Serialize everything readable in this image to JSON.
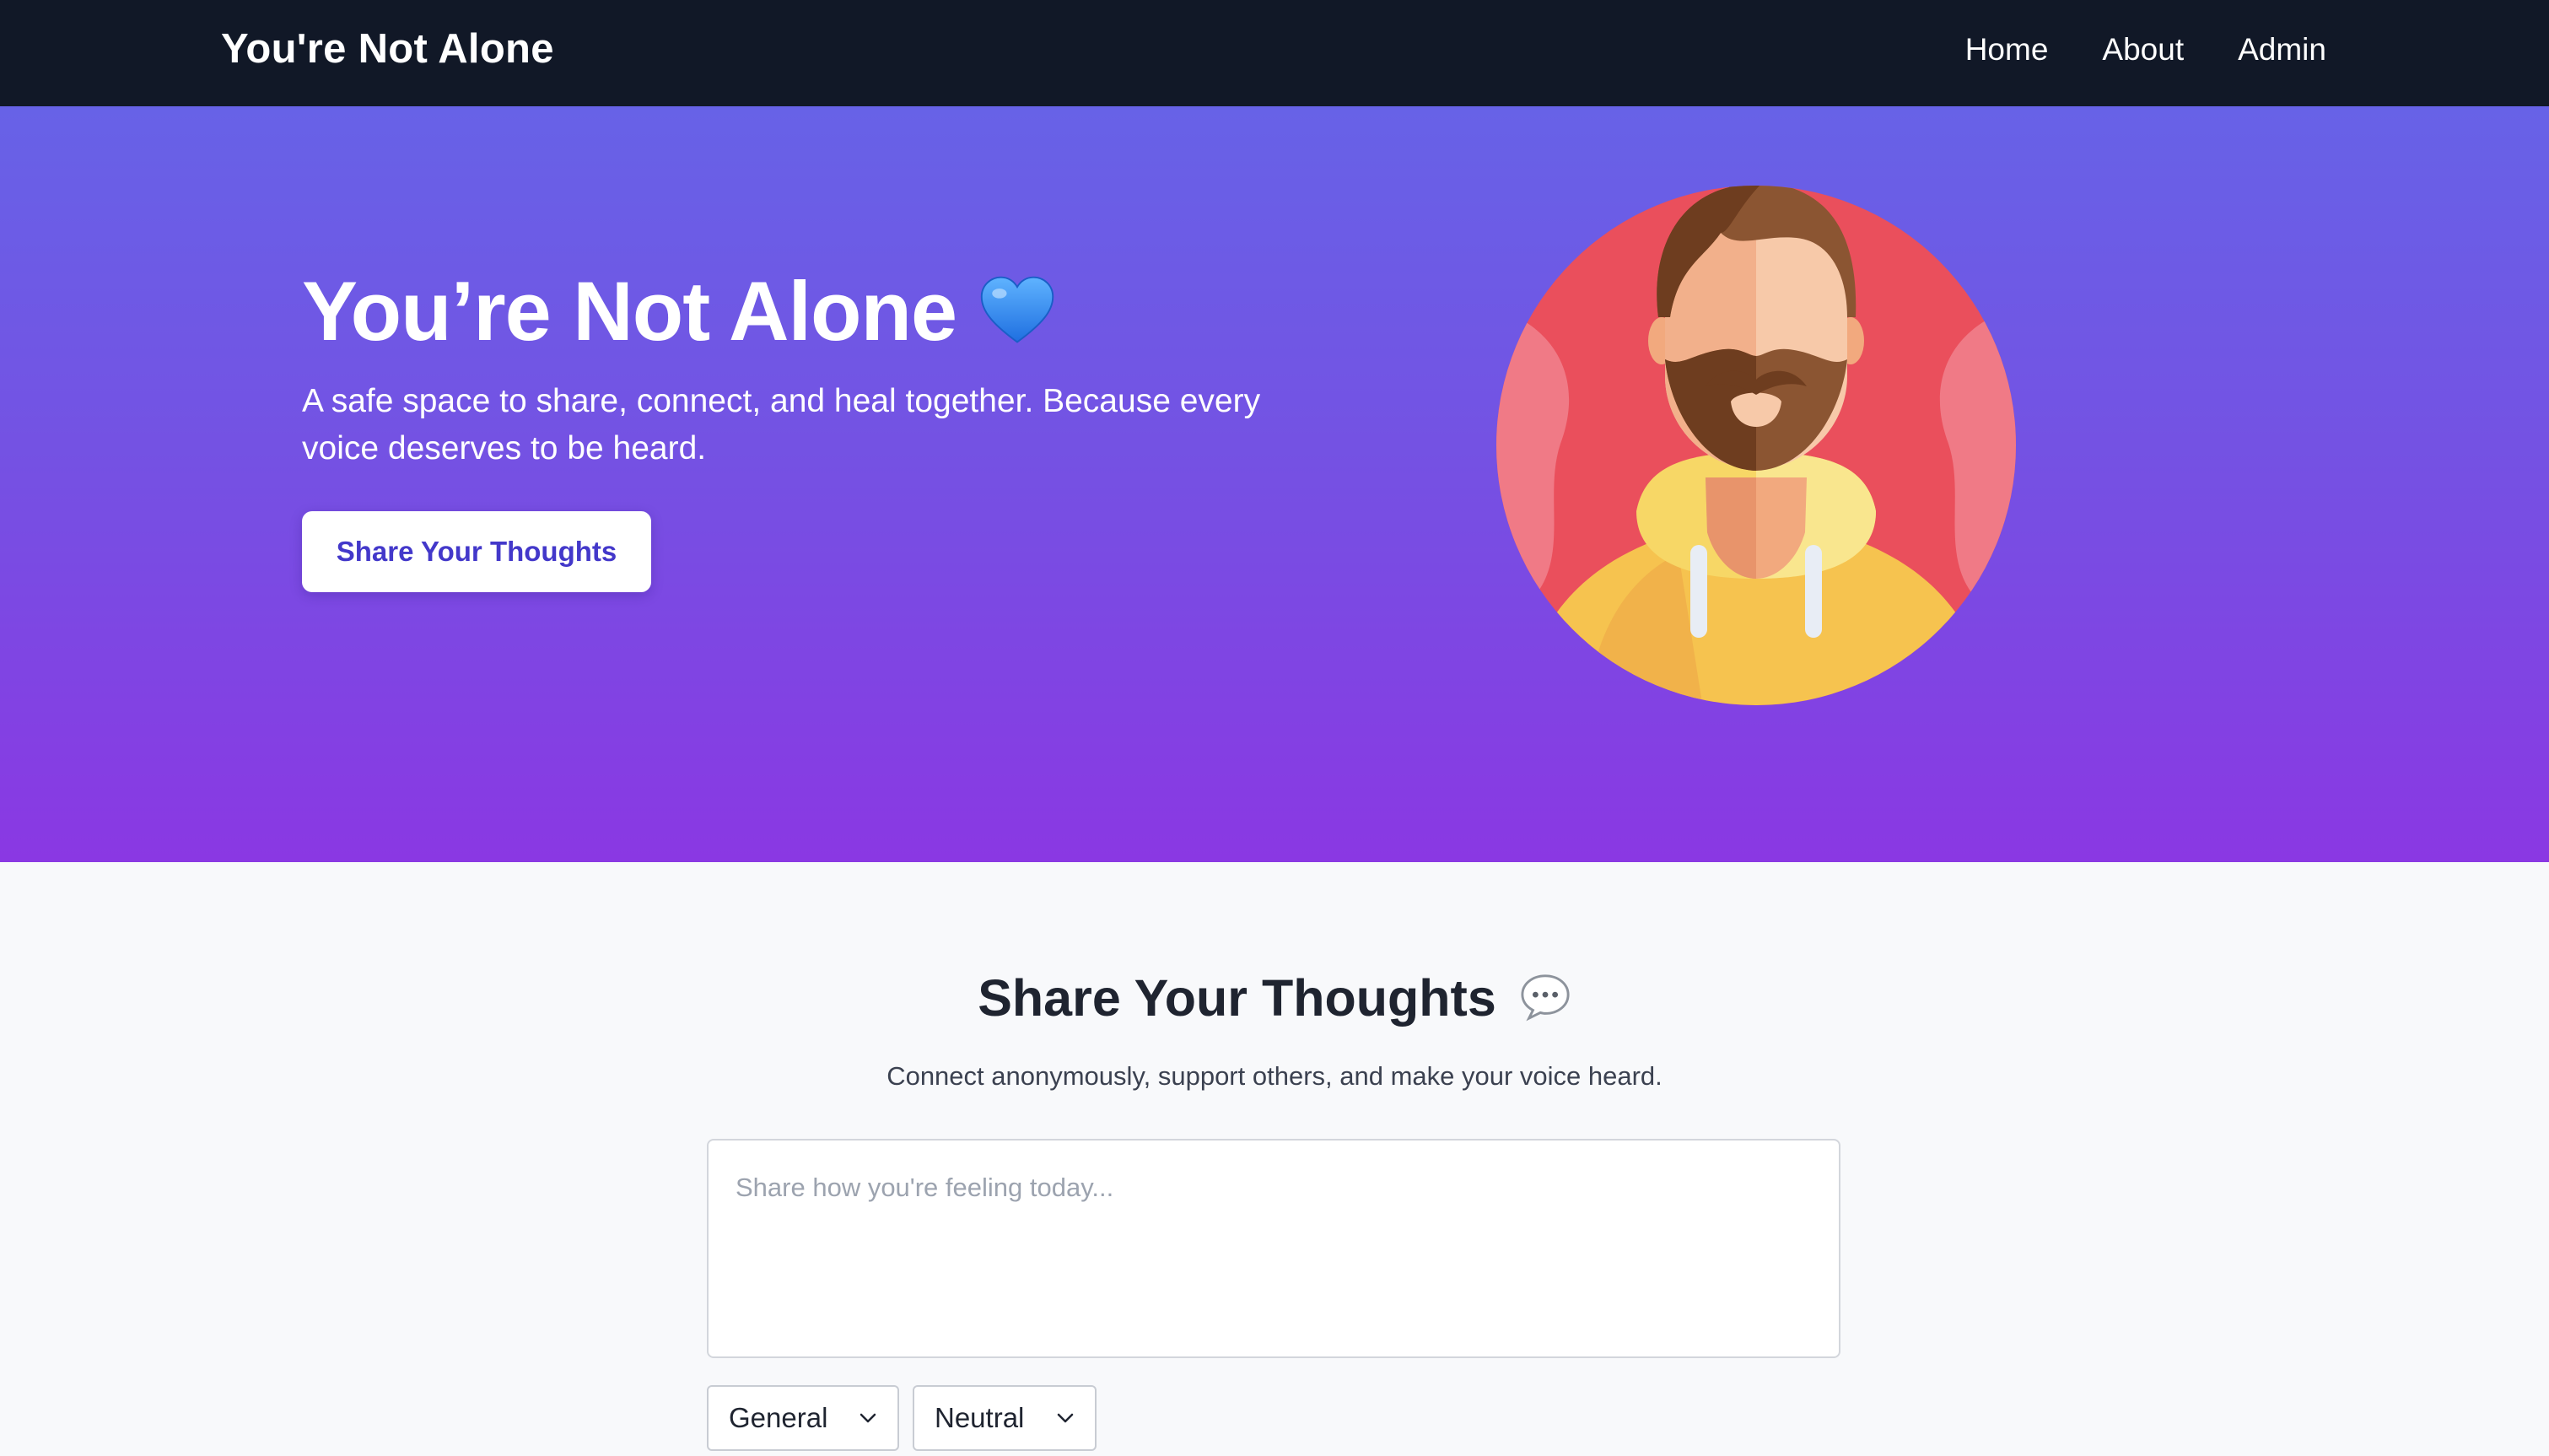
{
  "navbar": {
    "brand": "You're Not Alone",
    "links": [
      {
        "label": "Home"
      },
      {
        "label": "About"
      },
      {
        "label": "Admin"
      }
    ]
  },
  "hero": {
    "title": "You’re Not Alone",
    "title_icon": "blue-heart-icon",
    "subtitle": "A safe space to share, connect, and heal together. Because every voice deserves to be heard.",
    "cta_label": "Share Your Thoughts",
    "illustration": "bearded-man-avatar"
  },
  "share": {
    "title": "Share Your Thoughts",
    "title_icon": "speech-bubble-icon",
    "subtitle": "Connect anonymously, support others, and make your voice heard.",
    "input_placeholder": "Share how you're feeling today...",
    "category_selected": "General",
    "mood_selected": "Neutral"
  },
  "colors": {
    "navbar_bg": "#111827",
    "hero_gradient_top": "#6762e7",
    "hero_gradient_bottom": "#8a38e3",
    "cta_text": "#4338ca",
    "page_bg": "#f8f9fb"
  }
}
